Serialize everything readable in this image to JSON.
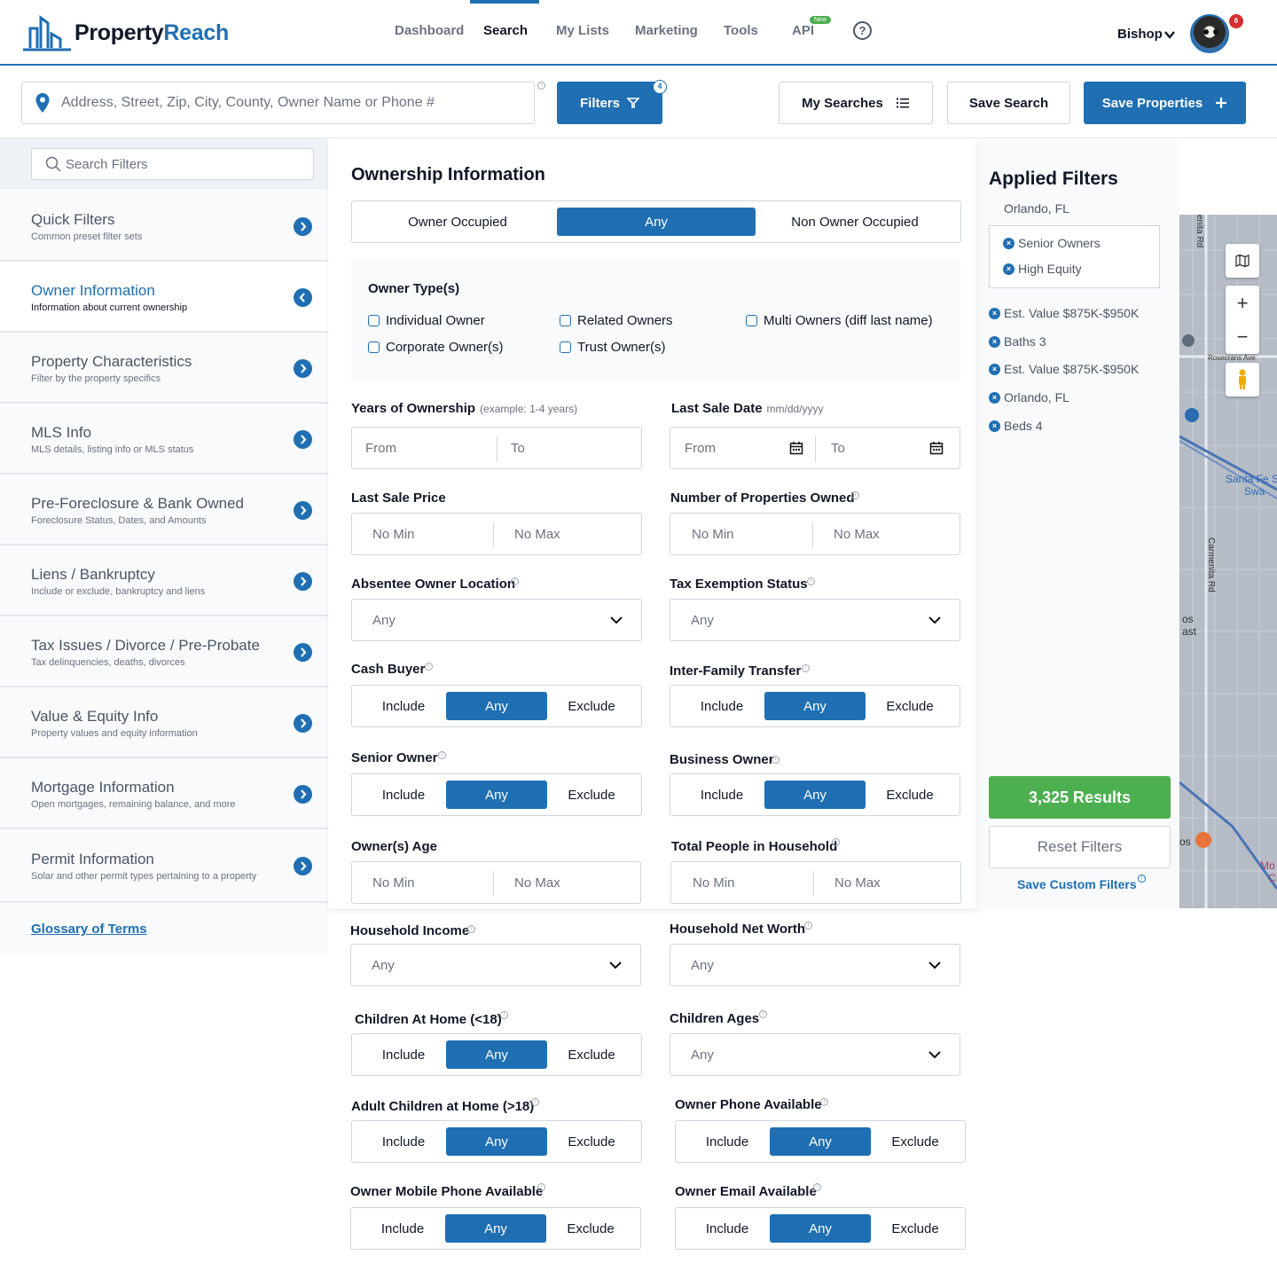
{
  "app": {
    "logo_part1": "Property",
    "logo_part2": "Reach"
  },
  "nav": {
    "items": [
      {
        "label": "Dashboard"
      },
      {
        "label": "Search"
      },
      {
        "label": "My Lists"
      },
      {
        "label": "Marketing"
      },
      {
        "label": "Tools"
      },
      {
        "label": "API"
      }
    ],
    "new_badge": "New",
    "help_symbol": "?",
    "user_name": "Bishop",
    "notification_count": "6"
  },
  "search": {
    "placeholder": "Address, Street, Zip, City, County, Owner Name or Phone #",
    "filters_label": "Filters",
    "filters_count": "4",
    "my_searches_label": "My Searches",
    "save_search_label": "Save Search",
    "save_properties_label": "Save Properties"
  },
  "sidebar": {
    "search_placeholder": "Search Filters",
    "items": [
      {
        "title": "Quick Filters",
        "subtitle": "Common preset filter sets"
      },
      {
        "title": "Owner Information",
        "subtitle": "Information about current ownership"
      },
      {
        "title": "Property Characteristics",
        "subtitle": "Filter by the property specifics"
      },
      {
        "title": "MLS Info",
        "subtitle": "MLS details, listing info or MLS status"
      },
      {
        "title": "Pre-Foreclosure & Bank Owned",
        "subtitle": "Foreclosure Status, Dates, and Amounts"
      },
      {
        "title": "Liens / Bankruptcy",
        "subtitle": "Include or exclude, bankruptcy and liens"
      },
      {
        "title": "Tax Issues / Divorce / Pre-Probate",
        "subtitle": "Tax delinquencies, deaths, divorces"
      },
      {
        "title": "Value & Equity Info",
        "subtitle": "Property values and equity information"
      },
      {
        "title": "Mortgage Information",
        "subtitle": "Open mortgages, remaining balance, and more"
      },
      {
        "title": "Permit Information",
        "subtitle": "Solar and other permit types pertaining to a property"
      }
    ],
    "glossary": "Glossary of Terms"
  },
  "form": {
    "section_title": "Ownership Information",
    "occupancy": {
      "options": [
        "Owner Occupied",
        "Any",
        "Non Owner Occupied"
      ],
      "selected": "Any"
    },
    "owner_types": {
      "label": "Owner Type(s)",
      "options": [
        "Individual Owner",
        "Related Owners",
        "Multi Owners (diff last name)",
        "Corporate Owner(s)",
        "Trust Owner(s)"
      ]
    },
    "years_ownership": {
      "label": "Years of Ownership",
      "hint": "(example: 1-4 years)",
      "from": "From",
      "to": "To"
    },
    "last_sale_date": {
      "label": "Last Sale Date",
      "hint": "mm/dd/yyyy",
      "from": "From",
      "to": "To"
    },
    "last_sale_price": {
      "label": "Last Sale Price",
      "min": "No Min",
      "max": "No Max"
    },
    "num_properties": {
      "label": "Number of Properties Owned",
      "min": "No Min",
      "max": "No Max"
    },
    "absentee": {
      "label": "Absentee Owner Location",
      "value": "Any"
    },
    "tax_exemption": {
      "label": "Tax Exemption Status",
      "value": "Any"
    },
    "cash_buyer": {
      "label": "Cash Buyer",
      "options": [
        "Include",
        "Any",
        "Exclude"
      ]
    },
    "inter_family": {
      "label": "Inter-Family Transfer",
      "options": [
        "Include",
        "Any",
        "Exclude"
      ]
    },
    "senior_owner": {
      "label": "Senior Owner",
      "options": [
        "Include",
        "Any",
        "Exclude"
      ]
    },
    "business_owner": {
      "label": "Business Owner",
      "options": [
        "Include",
        "Any",
        "Exclude"
      ]
    },
    "owner_age": {
      "label": "Owner(s) Age",
      "min": "No Min",
      "max": "No Max"
    },
    "household_people": {
      "label": "Total People in Household",
      "min": "No Min",
      "max": "No Max"
    },
    "household_income": {
      "label": "Household Income",
      "value": "Any"
    },
    "net_worth": {
      "label": "Household Net Worth",
      "value": "Any"
    },
    "children_home": {
      "label": "Children At Home (<18)",
      "options": [
        "Include",
        "Any",
        "Exclude"
      ]
    },
    "children_ages": {
      "label": "Children Ages",
      "value": "Any"
    },
    "adult_children": {
      "label": "Adult Children at Home (>18)",
      "options": [
        "Include",
        "Any",
        "Exclude"
      ]
    },
    "owner_phone": {
      "label": "Owner Phone Available",
      "options": [
        "Include",
        "Any",
        "Exclude"
      ]
    },
    "owner_mobile": {
      "label": "Owner Mobile Phone Available",
      "options": [
        "Include",
        "Any",
        "Exclude"
      ]
    },
    "owner_email": {
      "label": "Owner Email Available",
      "options": [
        "Include",
        "Any",
        "Exclude"
      ]
    }
  },
  "applied": {
    "title": "Applied Filters",
    "location": "Orlando, FL",
    "group_chips": [
      "Senior Owners",
      "High Equity"
    ],
    "chips": [
      "Est. Value $875K-$950K",
      "Baths 3",
      "Est. Value $875K-$950K",
      "Orlando, FL",
      "Beds 4"
    ],
    "results_label": "3,325 Results",
    "reset_label": "Reset Filters",
    "save_custom_label": "Save Custom Filters"
  },
  "map": {
    "zoom_in": "+",
    "zoom_out": "−",
    "labels": [
      "Santa Fe S",
      "Swa",
      "Rosecrans Ave",
      "Carmenita Rd",
      "enita Rd",
      "os",
      "ast",
      "os",
      "Mo",
      "C"
    ]
  },
  "colors": {
    "primary": "#1f6fb2",
    "success": "#4caf50",
    "notification": "#d32f2f"
  }
}
